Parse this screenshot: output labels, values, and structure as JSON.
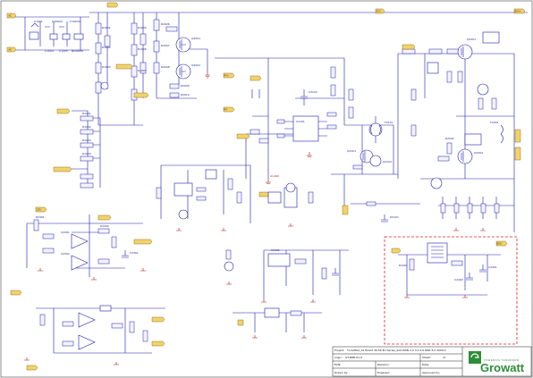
{
  "labels": {
    "refs_top": [
      "R2006",
      "R2007",
      "R2008",
      "Q2001",
      "Q2002",
      "R2009",
      "R2010"
    ],
    "refs_mid": [
      "U2101",
      "C2102",
      "T2101",
      "Q2101",
      "Q2102",
      "D2101"
    ],
    "refs_right": [
      "R2201",
      "Q2201",
      "Q2202",
      "R2202",
      "T2201"
    ],
    "refs_left": [
      "U2301",
      "U2302",
      "R2301",
      "R2302",
      "C2301"
    ],
    "refs_box": [
      "U2401",
      "C2401",
      "C2402",
      "R2401"
    ],
    "power_tags": [
      "VCC",
      "BUS+",
      "BUS-",
      "15V",
      "PV+",
      "PV-"
    ]
  },
  "nets": {
    "ground_label": "AC-GND"
  },
  "titleblock": {
    "project_label": "Project:",
    "project_value": "TL-S/MAX_01 Board 3K-5K EU Series_SCH.DSN 2.0 3.0 4.0 NSR-3.0 2009.0",
    "logic_label": "Logic:",
    "logic_value": "GT-MPR-01.0",
    "sheet_label": "Sheet:",
    "sheet_value": "of",
    "ecn_label": "ECN:",
    "revision_label": "Revision:",
    "date_label": "Date:",
    "drawn_label": "Drawn by:",
    "engineer_label": "Engineer:",
    "approved_label": "Approved by:",
    "logo_text": "Growatt",
    "logo_subtitle": "POWERING TOMORROW"
  },
  "colors": {
    "wire": "#1c1cb4",
    "tag_fill": "#f2d36b",
    "highlight_box": "#e02020",
    "logo": "#2f8d3a"
  }
}
